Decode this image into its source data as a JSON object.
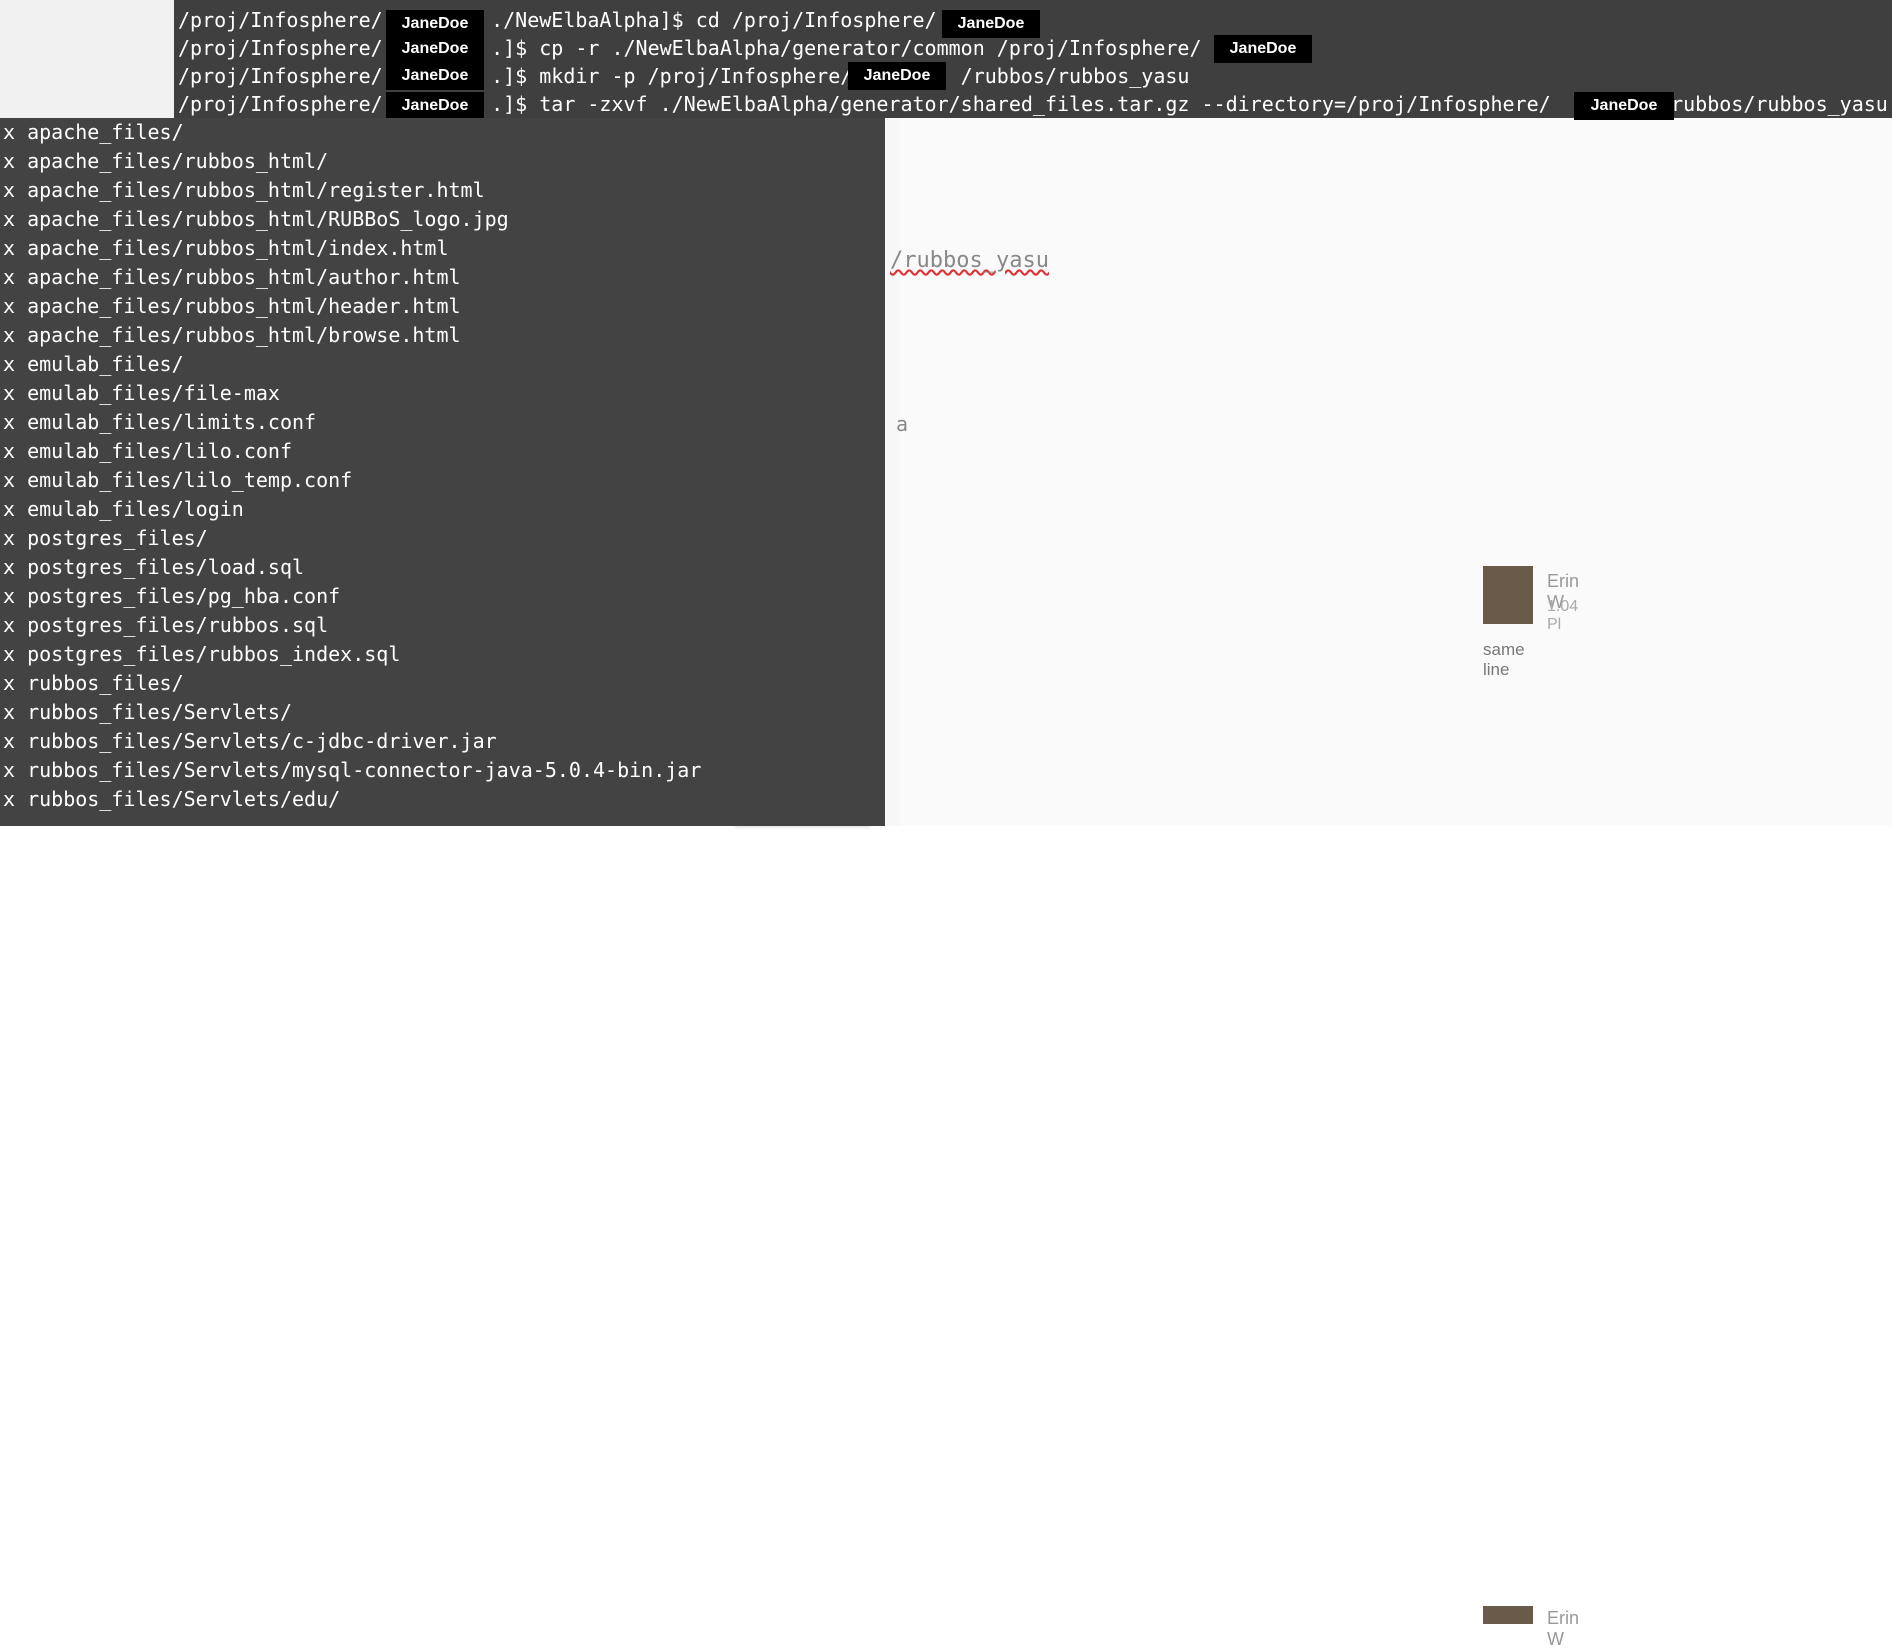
{
  "background_doc": {
    "comment_author": "Erin W",
    "comment_time": "1:04 Pl",
    "comment_text": "same line",
    "path_fragment": "/rubbos_yasu",
    "fragment_a": "a"
  },
  "top_terminal": {
    "redaction_label": "JaneDoe",
    "lines": [
      "/proj/Infosphere/         ./NewElbaAlpha]$ cd /proj/Infosphere/",
      "/proj/Infosphere/         .]$ cp -r ./NewElbaAlpha/generator/common /proj/Infosphere/",
      "/proj/Infosphere/         .]$ mkdir -p /proj/Infosphere/         /rubbos/rubbos_yasu",
      "/proj/Infosphere/         .]$ tar -zxvf ./NewElbaAlpha/generator/shared_files.tar.gz --directory=/proj/Infosphere/         /rubbos/rubbos_yasu"
    ]
  },
  "file_listing": [
    "x apache_files/",
    "x apache_files/rubbos_html/",
    "x apache_files/rubbos_html/register.html",
    "x apache_files/rubbos_html/RUBBoS_logo.jpg",
    "x apache_files/rubbos_html/index.html",
    "x apache_files/rubbos_html/author.html",
    "x apache_files/rubbos_html/header.html",
    "x apache_files/rubbos_html/browse.html",
    "x emulab_files/",
    "x emulab_files/file-max",
    "x emulab_files/limits.conf",
    "x emulab_files/lilo.conf",
    "x emulab_files/lilo_temp.conf",
    "x emulab_files/login",
    "x postgres_files/",
    "x postgres_files/load.sql",
    "x postgres_files/pg_hba.conf",
    "x postgres_files/rubbos.sql",
    "x postgres_files/rubbos_index.sql",
    "x rubbos_files/",
    "x rubbos_files/Servlets/",
    "x rubbos_files/Servlets/c-jdbc-driver.jar",
    "x rubbos_files/Servlets/mysql-connector-java-5.0.4-bin.jar",
    "x rubbos_files/Servlets/edu/"
  ]
}
